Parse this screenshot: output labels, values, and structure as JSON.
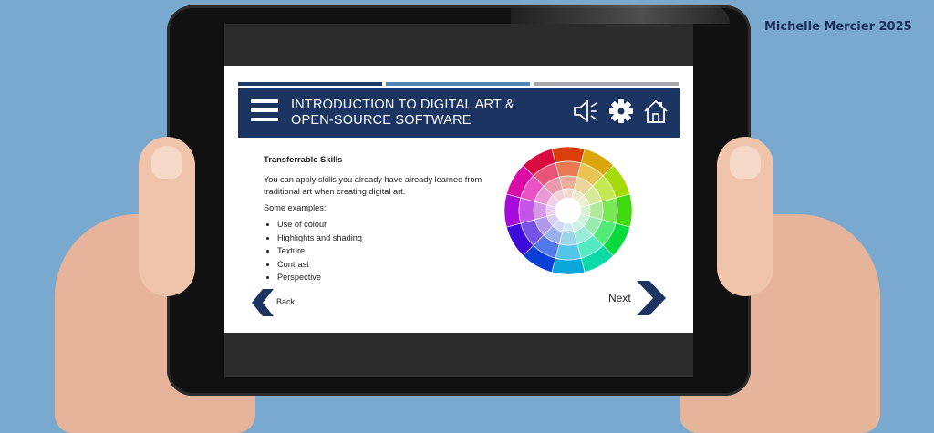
{
  "author_credit": "Michelle Mercier 2025",
  "course": {
    "title_line1": "INTRODUCTION TO DIGITAL ART &",
    "title_line2": "OPEN-SOURCE SOFTWARE"
  },
  "progress_segments": [
    {
      "color": "#1f3a66"
    },
    {
      "color": "#4b86b4"
    },
    {
      "color": "#a7a9ac"
    }
  ],
  "header_icons": [
    "menu-icon",
    "speaker-icon",
    "gear-icon",
    "home-icon"
  ],
  "lesson": {
    "heading": "Transferrable Skills",
    "paragraph": "You can apply skills you already have already learned from traditional art when creating digital art.",
    "examples_label": "Some examples:",
    "examples": [
      "Use of colour",
      "Highlights and shading",
      "Texture",
      "Contrast",
      "Perspective"
    ]
  },
  "navigation": {
    "back_label": "Back",
    "next_label": "Next"
  },
  "colors": {
    "header_bg": "#1c3461",
    "background": "#7aa9cf",
    "nav_chevron": "#1c3461"
  }
}
